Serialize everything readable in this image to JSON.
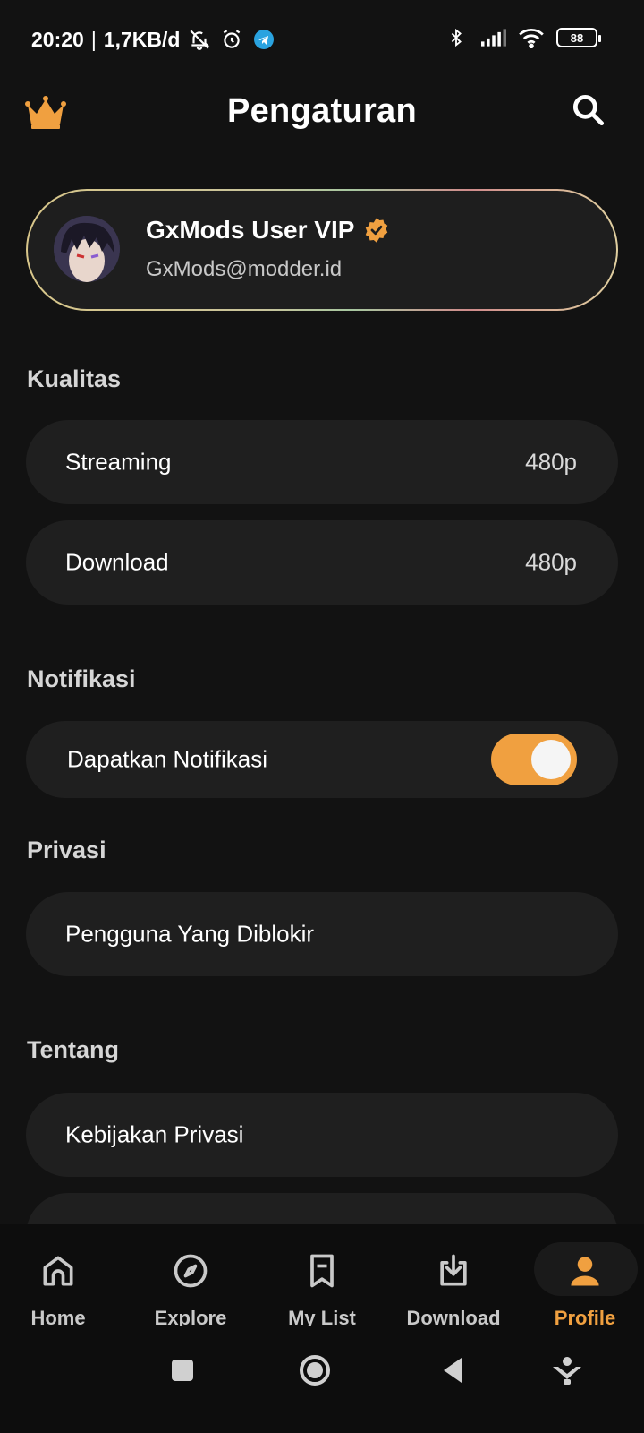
{
  "status_bar": {
    "time": "20:20",
    "separator": "|",
    "speed": "1,7KB/d",
    "battery": "88"
  },
  "header": {
    "title": "Pengaturan",
    "crown_color": "#F0A040"
  },
  "profile": {
    "name": "GxMods User VIP",
    "email": "GxMods@modder.id"
  },
  "sections": {
    "quality": {
      "title": "Kualitas",
      "streaming": {
        "label": "Streaming",
        "value": "480p"
      },
      "download": {
        "label": "Download",
        "value": "480p"
      }
    },
    "notification": {
      "title": "Notifikasi",
      "get_notifications": {
        "label": "Dapatkan Notifikasi",
        "enabled": true
      }
    },
    "privacy": {
      "title": "Privasi",
      "blocked_users": {
        "label": "Pengguna Yang Diblokir"
      }
    },
    "about": {
      "title": "Tentang",
      "privacy_policy": {
        "label": "Kebijakan Privasi"
      }
    }
  },
  "bottom_nav": [
    {
      "label": "Home",
      "icon": "home-icon"
    },
    {
      "label": "Explore",
      "icon": "compass-icon"
    },
    {
      "label": "My List",
      "icon": "bookmark-icon"
    },
    {
      "label": "Download",
      "icon": "download-icon"
    },
    {
      "label": "Profile",
      "icon": "user-icon",
      "active": true
    }
  ],
  "colors": {
    "background": "#121212",
    "card": "#1F1F1F",
    "accent": "#F0A040"
  }
}
